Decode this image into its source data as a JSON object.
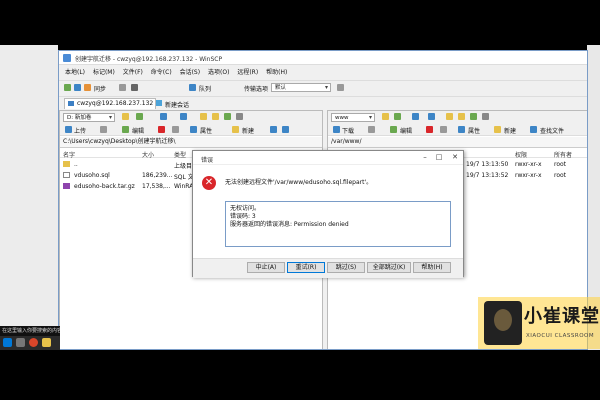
{
  "window": {
    "title": "创建宇航迁移 - cwzyq@192.168.237.132 - WinSCP"
  },
  "menu": [
    "本地(L)",
    "标记(M)",
    "文件(F)",
    "命令(C)",
    "会话(S)",
    "选项(O)",
    "远程(R)",
    "帮助(H)"
  ],
  "toolbar": {
    "sync_label": "同步",
    "queue_label": "队列",
    "transfer_settings_label": "传输选项",
    "transfer_settings_value": "默认"
  },
  "session": {
    "tab_label": "cwzyq@192.168.237.132",
    "new_session_label": "新建会话"
  },
  "left_panel": {
    "drive": "D: 新加卷",
    "upload_label": "上传",
    "edit_label": "编辑",
    "properties_label": "属性",
    "new_label": "新建",
    "path": "C:\\Users\\cwzyq\\Desktop\\创建宇航迁移\\",
    "columns": [
      "名字",
      "大小",
      "类型"
    ],
    "rows": [
      {
        "name": "..",
        "size": "",
        "type": "上级目录"
      },
      {
        "name": "vdusoho.sql",
        "size": "186,239...",
        "type": "SQL 文件"
      },
      {
        "name": "edusoho-back.tar.gz",
        "size": "17,538,...",
        "type": "WinRAR"
      }
    ]
  },
  "right_panel": {
    "folder": "www",
    "download_label": "下载",
    "edit_label": "编辑",
    "properties_label": "属性",
    "new_label": "新建",
    "find_files_label": "查找文件",
    "path": "/var/www/",
    "columns": [
      "名字",
      "权限",
      "所有者"
    ],
    "rows": [
      {
        "name": "..",
        "date": "19/7 13:13:50",
        "rights": "rwxr-xr-x",
        "owner": "root"
      },
      {
        "name": "",
        "date": "19/7 13:13:52",
        "rights": "rwxr-xr-x",
        "owner": "root"
      }
    ]
  },
  "dialog": {
    "title": "错误",
    "message": "无法创建远程文件'/var/www/edusoho.sql.filepart'。",
    "details": [
      "无权访问。",
      "错误码: 3",
      "服务器返回的错误消息: Permission denied"
    ],
    "buttons": [
      "中止(A)",
      "重试(R)",
      "跳过(S)",
      "全部跳过(K)",
      "帮助(H)"
    ]
  },
  "taskbar": {
    "tooltip": "在这里输入你要搜索的内容"
  },
  "watermark": {
    "main": "小崔课堂",
    "sub": "XIAOCUI CLASSROOM"
  },
  "colors": {
    "error_red": "#d9262a",
    "accent_blue": "#0078d7",
    "watermark_yellow": "#ffd23c"
  }
}
